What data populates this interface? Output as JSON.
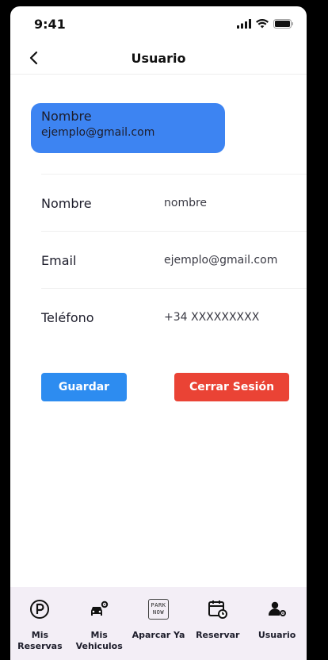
{
  "status_bar": {
    "time": "9:41"
  },
  "header": {
    "title": "Usuario"
  },
  "profile": {
    "name": "Nombre",
    "email": "ejemplo@gmail.com"
  },
  "form": {
    "rows": [
      {
        "label": "Nombre",
        "value": "nombre"
      },
      {
        "label": "Email",
        "value": "ejemplo@gmail.com"
      },
      {
        "label": "Teléfono",
        "value": "+34 XXXXXXXXX"
      }
    ]
  },
  "buttons": {
    "save": "Guardar",
    "logout": "Cerrar Sesión"
  },
  "colors": {
    "primary": "#3d84f2",
    "save": "#2d8cf0",
    "danger": "#ea4335",
    "nav_bg": "#f3eef6"
  },
  "nav": {
    "items": [
      {
        "label": "Mis Reservas",
        "icon": "parking-circle-icon"
      },
      {
        "label": "Mis Vehiculos",
        "icon": "car-gear-icon"
      },
      {
        "label": "Aparcar Ya",
        "icon": "park-now-icon",
        "badge": "PARK NOW"
      },
      {
        "label": "Reservar",
        "icon": "calendar-clock-icon"
      },
      {
        "label": "Usuario",
        "icon": "user-gear-icon"
      }
    ]
  }
}
